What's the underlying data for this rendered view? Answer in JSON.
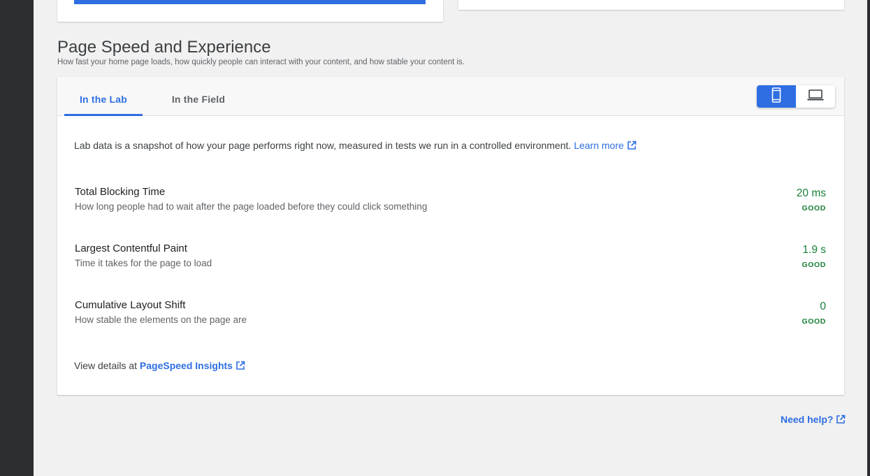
{
  "section": {
    "title": "Page Speed and Experience",
    "subtitle": "How fast your home page loads, how quickly people can interact with your content, and how stable your content is."
  },
  "tabs": [
    {
      "label": "In the Lab",
      "active": true
    },
    {
      "label": "In the Field",
      "active": false
    }
  ],
  "device_toggle": {
    "options": [
      "mobile-icon",
      "laptop-icon"
    ],
    "selected": "mobile"
  },
  "intro": {
    "text": "Lab data is a snapshot of how your page performs right now, measured in tests we run in a controlled environment.",
    "link": "Learn more"
  },
  "metrics": [
    {
      "name": "Total Blocking Time",
      "description": "How long people had to wait after the page loaded before they could click something",
      "value": "20 ms",
      "status": "GOOD"
    },
    {
      "name": "Largest Contentful Paint",
      "description": "Time it takes for the page to load",
      "value": "1.9 s",
      "status": "GOOD"
    },
    {
      "name": "Cumulative Layout Shift",
      "description": "How stable the elements on the page are",
      "value": "0",
      "status": "GOOD"
    }
  ],
  "details": {
    "prefix": "View details at",
    "link": "PageSpeed Insights"
  },
  "help": {
    "link": "Need help?"
  },
  "colors": {
    "accent": "#2e6ee2",
    "good": "#188038",
    "rail": "#2c2d30",
    "background": "#f1f1f1"
  }
}
